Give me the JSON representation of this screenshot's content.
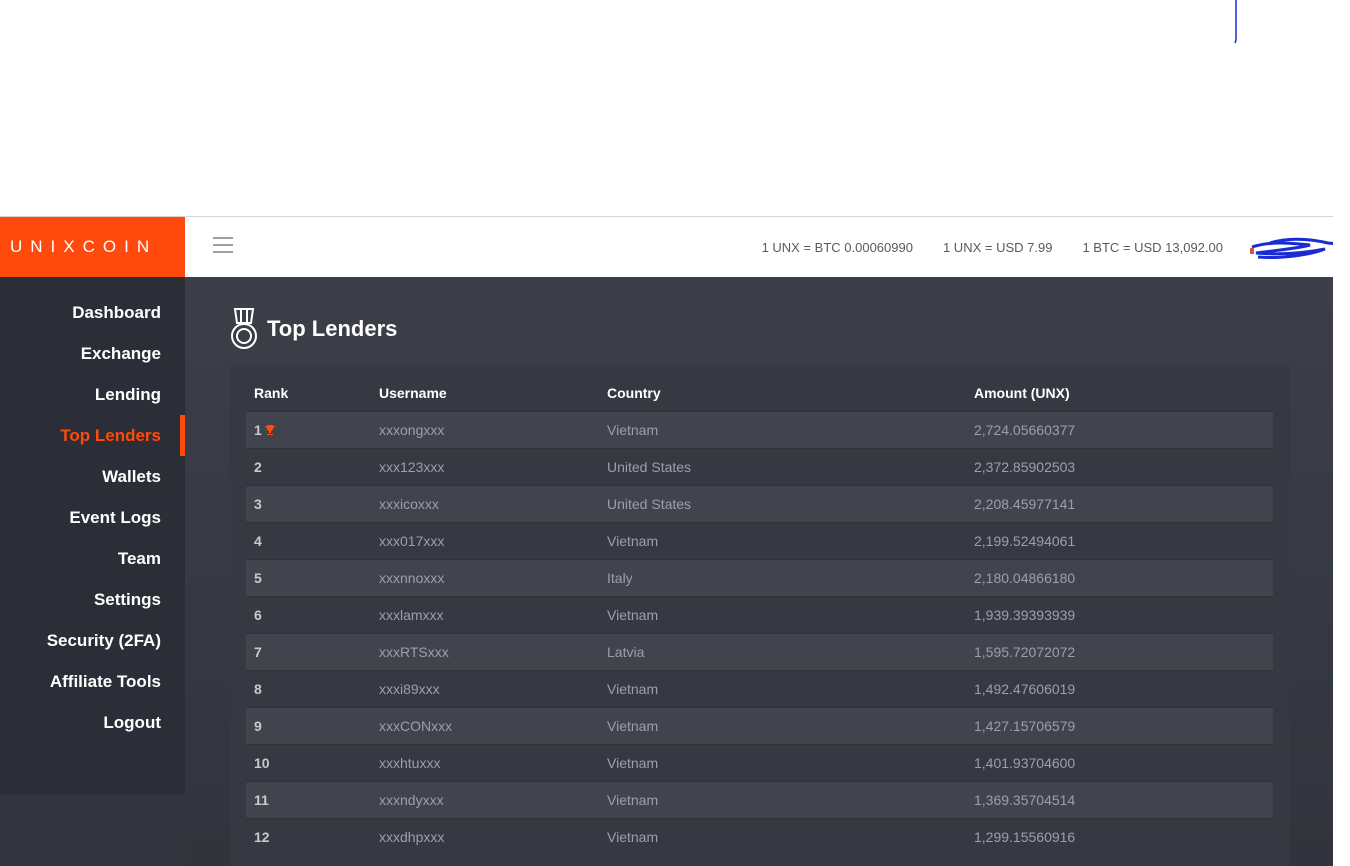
{
  "brand": {
    "name": "UNIXCOIN",
    "color": "#ff4a0d"
  },
  "header": {
    "rates": [
      "1 UNX = BTC 0.00060990",
      "1 UNX = USD 7.99",
      "1 BTC = USD 13,092.00"
    ]
  },
  "sidebar": {
    "items": [
      {
        "label": "Dashboard",
        "active": false
      },
      {
        "label": "Exchange",
        "active": false
      },
      {
        "label": "Lending",
        "active": false
      },
      {
        "label": "Top Lenders",
        "active": true
      },
      {
        "label": "Wallets",
        "active": false
      },
      {
        "label": "Event Logs",
        "active": false
      },
      {
        "label": "Team",
        "active": false
      },
      {
        "label": "Settings",
        "active": false
      },
      {
        "label": "Security (2FA)",
        "active": false
      },
      {
        "label": "Affiliate Tools",
        "active": false
      },
      {
        "label": "Logout",
        "active": false
      }
    ]
  },
  "page": {
    "title": "Top Lenders",
    "icon": "medal-icon"
  },
  "table": {
    "headers": [
      "Rank",
      "Username",
      "Country",
      "Amount (UNX)"
    ],
    "rows": [
      {
        "rank": "1",
        "username": "xxxongxxx",
        "country": "Vietnam",
        "amount": "2,724.05660377"
      },
      {
        "rank": "2",
        "username": "xxx123xxx",
        "country": "United States",
        "amount": "2,372.85902503"
      },
      {
        "rank": "3",
        "username": "xxxicoxxx",
        "country": "United States",
        "amount": "2,208.45977141"
      },
      {
        "rank": "4",
        "username": "xxx017xxx",
        "country": "Vietnam",
        "amount": "2,199.52494061"
      },
      {
        "rank": "5",
        "username": "xxxnnoxxx",
        "country": "Italy",
        "amount": "2,180.04866180"
      },
      {
        "rank": "6",
        "username": "xxxlamxxx",
        "country": "Vietnam",
        "amount": "1,939.39393939"
      },
      {
        "rank": "7",
        "username": "xxxRTSxxx",
        "country": "Latvia",
        "amount": "1,595.72072072"
      },
      {
        "rank": "8",
        "username": "xxxi89xxx",
        "country": "Vietnam",
        "amount": "1,492.47606019"
      },
      {
        "rank": "9",
        "username": "xxxCONxxx",
        "country": "Vietnam",
        "amount": "1,427.15706579"
      },
      {
        "rank": "10",
        "username": "xxxhtuxxx",
        "country": "Vietnam",
        "amount": "1,401.93704600"
      },
      {
        "rank": "11",
        "username": "xxxndyxxx",
        "country": "Vietnam",
        "amount": "1,369.35704514"
      },
      {
        "rank": "12",
        "username": "xxxdhpxxx",
        "country": "Vietnam",
        "amount": "1,299.15560916"
      }
    ]
  }
}
